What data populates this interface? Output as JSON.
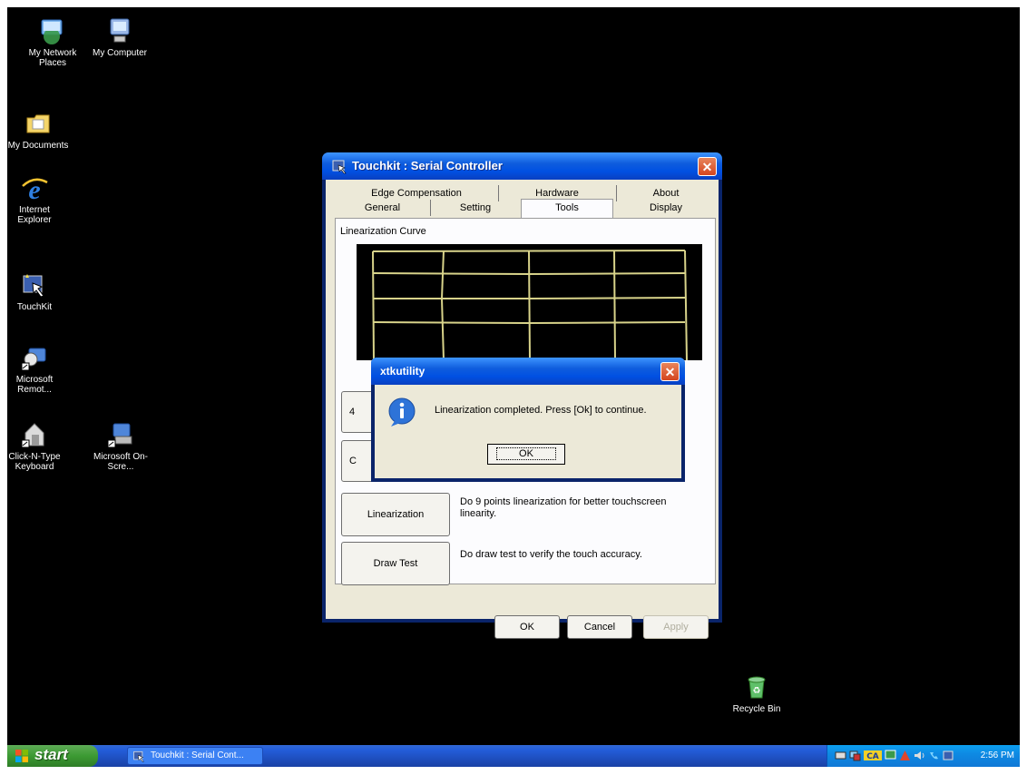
{
  "desktop": {
    "icons": {
      "network_places": "My Network Places",
      "my_computer": "My Computer",
      "my_documents": "My Documents",
      "internet_explorer": "Internet Explorer",
      "touchkit": "TouchKit",
      "ms_remote": "Microsoft Remot...",
      "clickntype": "Click-N-Type Keyboard",
      "ms_onscreen": "Microsoft On-Scre...",
      "recycle_bin": "Recycle Bin"
    }
  },
  "window": {
    "title": "Touchkit : Serial Controller",
    "tabs_back": [
      "Edge Compensation",
      "Hardware",
      "About"
    ],
    "tabs_front": [
      "General",
      "Setting",
      "Tools",
      "Display"
    ],
    "active_tab": "Tools",
    "curve_label": "Linearization Curve",
    "tools": [
      {
        "button": "4",
        "desc": ""
      },
      {
        "button": "C",
        "desc": ""
      },
      {
        "button": "Linearization",
        "desc": "Do 9 points linearization for better touchscreen linearity."
      },
      {
        "button": "Draw Test",
        "desc": "Do draw test to verify the touch accuracy."
      }
    ],
    "footer": {
      "ok": "OK",
      "cancel": "Cancel",
      "apply": "Apply"
    },
    "close": "✕"
  },
  "msgbox": {
    "title": "xtkutility",
    "message": "Linearization completed. Press [Ok] to continue.",
    "ok": "OK",
    "icon": "info-icon",
    "close": "✕"
  },
  "taskbar": {
    "start": "start",
    "task": "Touchkit : Serial Cont...",
    "clock": "2:56 PM"
  },
  "colors": {
    "xp_title_blue": "#0050e2",
    "dialog_face": "#ece9d8",
    "grid_line": "#d8d38a",
    "start_green": "#3c9a33"
  }
}
